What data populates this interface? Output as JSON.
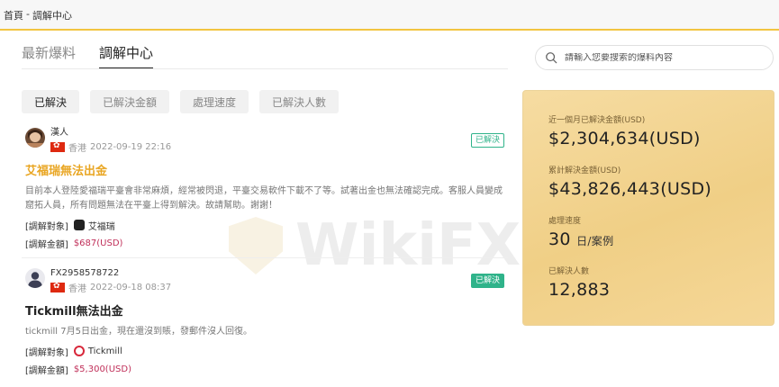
{
  "breadcrumb": {
    "home": "首頁",
    "separator": "-",
    "current": "調解中心"
  },
  "tabs": [
    {
      "label": "最新爆料"
    },
    {
      "label": "調解中心"
    }
  ],
  "search": {
    "placeholder": "請輸入您要搜索的爆料內容"
  },
  "filters": [
    {
      "label": "已解決"
    },
    {
      "label": "已解決金額"
    },
    {
      "label": "處理速度"
    },
    {
      "label": "已解決人數"
    }
  ],
  "posts": [
    {
      "username": "漢人",
      "region": "香港",
      "datetime": "2022-09-19 22:16",
      "badge": "已解決",
      "title": "艾福瑞無法出金",
      "body": "目前本人登陸愛福瑞平臺會非常麻煩，經常被閃退，平臺交易軟件下載不了等。試著出金也無法確認完成。客服人員變成窟拓人員，所有問題無法在平臺上得到解決。故請幫助。謝謝！",
      "target_label": "[調解對象]",
      "broker": "艾福瑞",
      "amount_label": "[調解金額]",
      "amount": "$687(USD)"
    },
    {
      "username": "FX2958578722",
      "region": "香港",
      "datetime": "2022-09-18 08:37",
      "badge": "已解決",
      "title": "Tickmill無法出金",
      "body": "tickmill 7月5日出金，現在還沒到賬，發郵件沒人回復。",
      "target_label": "[調解對象]",
      "broker": "Tickmill",
      "amount_label": "[調解金額]",
      "amount": "$5,300(USD)"
    }
  ],
  "stats": {
    "month_label": "近一個月已解決金額(USD)",
    "month_value": "$2,304,634",
    "month_unit": "(USD)",
    "total_label": "累計解決金額(USD)",
    "total_value": "$43,826,443",
    "total_unit": "(USD)",
    "speed_label": "處理速度",
    "speed_value": "30",
    "speed_unit": "日/案例",
    "people_label": "已解決人數",
    "people_value": "12,883"
  },
  "watermark": {
    "text": "WikiFX"
  },
  "colors": {
    "accent_gold": "#f2c440",
    "title_gold": "#e9a623",
    "resolved_green": "#2fb38a",
    "amount_red": "#c0305a"
  }
}
